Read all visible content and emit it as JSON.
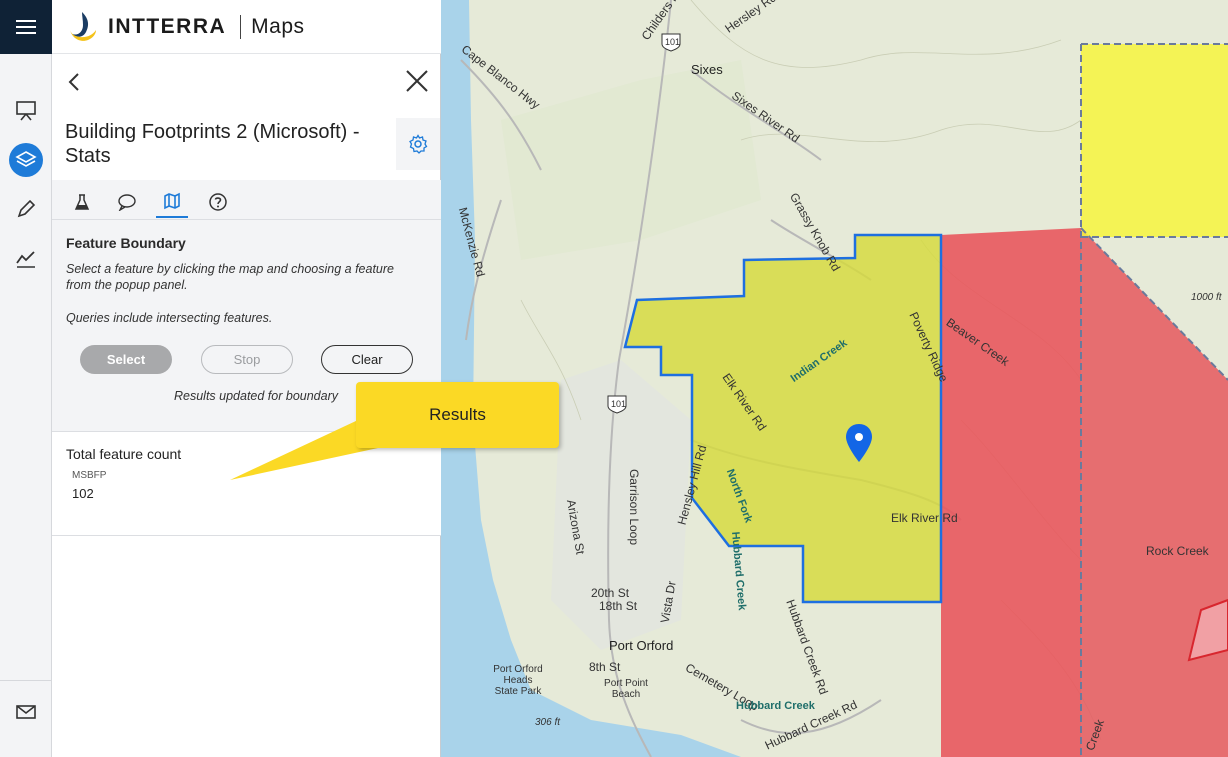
{
  "app": {
    "brand": "INTTERRA",
    "app_name": "Maps"
  },
  "panel": {
    "title": "Building Footprints 2 (Microsoft) - Stats",
    "tabs": [
      {
        "icon": "flask-icon"
      },
      {
        "icon": "speech-bubble-icon"
      },
      {
        "icon": "map-icon",
        "active": true
      },
      {
        "icon": "help-icon"
      }
    ],
    "boundary": {
      "title": "Feature Boundary",
      "description": "Select a feature by clicking the map and choosing a feature from the popup panel.",
      "note": "Queries include intersecting features.",
      "select_label": "Select",
      "stop_label": "Stop",
      "clear_label": "Clear",
      "status": "Results updated for boundary"
    },
    "results": {
      "title": "Total feature count",
      "source": "MSBFP",
      "value": "102"
    }
  },
  "callout": {
    "text": "Results"
  },
  "map": {
    "labels": {
      "childers_rd": "Childers Rd",
      "hersley_rd": "Hersley Rd",
      "cape_blanco_hwy": "Cape Blanco Hwy",
      "sixes": "Sixes",
      "sixes_river_rd": "Sixes River Rd",
      "grassy_knob_rd": "Grassy Knob Rd",
      "mckenzie_rd": "McKenzie Rd",
      "beaver_creek": "Beaver Creek",
      "poverty_ridge": "Poverty Ridge",
      "indian_creek": "Indian Creek",
      "elk_river_rd_1": "Elk River Rd",
      "elk_river_rd_2": "Elk River Rd",
      "north_fork": "North Fork",
      "hubbard_creek": "Hubbard Creek",
      "arizona_st": "Arizona St",
      "hensley_hill_rd": "Hensley Hill Rd",
      "garrison_loop": "Garrison Loop",
      "20th_st": "20th St",
      "18th_st": "18th St",
      "port_orford": "Port Orford",
      "8th_st": "8th St",
      "port_point_beach": "Port Point Beach",
      "port_orford_heads": "Port Orford Heads State Park",
      "306ft": "306 ft",
      "rock_creek": "Rock Creek",
      "1000ft": "1000 ft",
      "highway_101": "101",
      "cemetery_loop": "Cemetery Loop",
      "hubbard_creek_rd": "Hubbard Creek Rd",
      "vista_dr": "Vista Dr",
      "creek_bottom": "Creek"
    },
    "colors": {
      "selected_fill": "#d6da3c",
      "fire_fill": "#e8535a",
      "boundary_blue": "#1e6fe0",
      "pin_blue": "#1366e6",
      "ocean": "#a9d3ea"
    }
  }
}
